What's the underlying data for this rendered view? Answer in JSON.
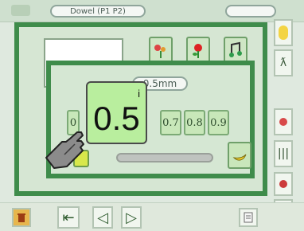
{
  "topbar": {
    "left_label": "Dowel (P1 P2)",
    "right_small_label": "",
    "right_pill": ""
  },
  "dialog": {
    "header_pill": "0.5mm",
    "big_value": "0.5",
    "big_info": "i",
    "values": [
      "0.7",
      "0.8",
      "0.9"
    ],
    "partial_left": "0"
  },
  "footer": {
    "prev": "◁",
    "next": "▷"
  },
  "colors": {
    "accent_frame": "#3f8c4b",
    "value_bg": "#b9ee9e"
  },
  "icons": [
    "flowers-icon",
    "flower-icon",
    "music-icon",
    "banana-icon",
    "hand-pointer-icon",
    "trash-icon",
    "document-icon"
  ]
}
